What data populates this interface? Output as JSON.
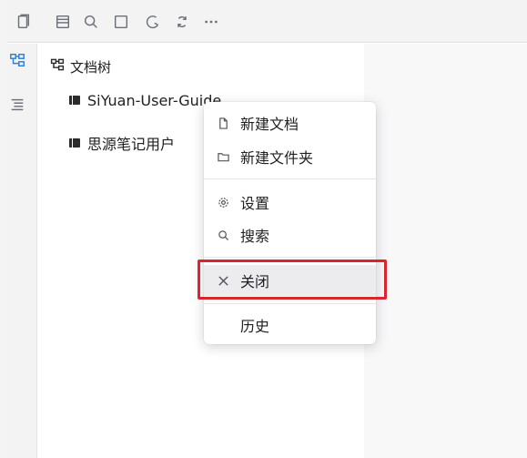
{
  "toolbar": {
    "icons": [
      "copy-icon",
      "calendar-icon",
      "search-icon",
      "square-icon",
      "moon-icon",
      "sync-icon",
      "more-icon"
    ]
  },
  "sidebar": {
    "icons": [
      "file-tree-icon",
      "outline-icon"
    ]
  },
  "filetree": {
    "title": "文档树",
    "notebooks": [
      {
        "label": "SiYuan-User-Guide"
      },
      {
        "label": "思源笔记用户"
      }
    ]
  },
  "context_menu": {
    "items": [
      {
        "label": "新建文档",
        "icon": "file-icon"
      },
      {
        "label": "新建文件夹",
        "icon": "folder-icon"
      },
      {
        "label": "设置",
        "icon": "gear-icon"
      },
      {
        "label": "搜索",
        "icon": "search-icon"
      },
      {
        "label": "关闭",
        "icon": "close-icon"
      },
      {
        "label": "历史",
        "icon": ""
      }
    ]
  },
  "colors": {
    "highlight_border": "#d9262c",
    "menu_background": "#ffffff",
    "hover_background": "#ececef"
  }
}
